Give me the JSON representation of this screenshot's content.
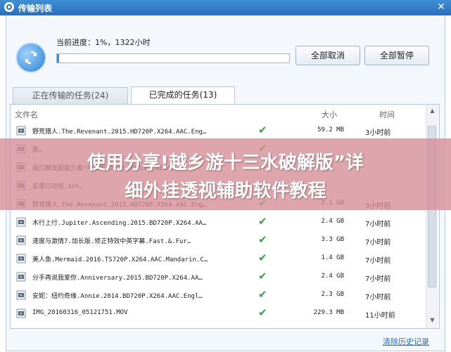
{
  "window": {
    "title": "传输列表",
    "close_glyph": "✕"
  },
  "progress": {
    "label": "当前进度：1%，1322小时",
    "percent": 1
  },
  "buttons": {
    "cancel_all": "全部取消",
    "pause_all": "全部暂停"
  },
  "tabs": [
    {
      "label": "正在传输的任务(24)"
    },
    {
      "label": "已完成的任务(13)"
    }
  ],
  "table": {
    "headers": {
      "name": "文件名",
      "size": "大小",
      "time": "时间"
    },
    "rows": [
      {
        "name": "野荒猎人.The.Revenant.2015.HD720P.X264.AAC.Eng…",
        "size": "59.2 MB",
        "time": "3小时前",
        "icon": "video-file-icon"
      },
      {
        "name": "那…",
        "size": "",
        "time": "",
        "icon": "video-file-icon"
      },
      {
        "name": "我们都是超能力者!电影版.2015.HD720P.X264…",
        "size": "",
        "time": "",
        "icon": "video-file-icon"
      },
      {
        "name": "反黑行动组.Ant…",
        "size": "",
        "time": "",
        "icon": "video-file-icon"
      },
      {
        "name": "野荒猎人.The.Revenant.2015.HD720P.X264.AAC.Eng…",
        "size": "3.1 GB",
        "time": "3小时前",
        "icon": "video-file-icon"
      },
      {
        "name": "木行上行.Jupiter.Ascending.2015.BD720P.X264.AA…",
        "size": "2.4 GB",
        "time": "7小时前",
        "icon": "video-file-icon"
      },
      {
        "name": "速度与激情7.加长版.修正特效中英字幕.Fast.&.Fur…",
        "size": "3.3 GB",
        "time": "7小时前",
        "icon": "video-file-icon"
      },
      {
        "name": "美人鱼.Mermaid.2016.TS720P.X264.AAC.Mandarin.C…",
        "size": "1.4 GB",
        "time": "7小时前",
        "icon": "video-file-icon"
      },
      {
        "name": "分手再说我爱你.Anniversary.2015.BD720P.X264.AA…",
        "size": "2.4 GB",
        "time": "7小时前",
        "icon": "video-file-icon"
      },
      {
        "name": "安妮：纽约奇缘.Annie.2014.BD720P.X264.AAC.Engl…",
        "size": "2.3 GB",
        "time": "7小时前",
        "icon": "video-file-icon"
      },
      {
        "name": "IMG_20160316_05121751.MOV",
        "size": "229.3 MB",
        "time": "11小时前",
        "icon": "video-file-icon"
      }
    ]
  },
  "footer": {
    "clear_history": "清除历史记录"
  },
  "overlay": {
    "line1": "使用分享!越乡游十三水破解版”详",
    "line2": "细外挂透视辅助软件教程"
  },
  "colors": {
    "accent": "#2a6fb8",
    "check": "#3a9d4a",
    "overlay": "#d68c96"
  }
}
